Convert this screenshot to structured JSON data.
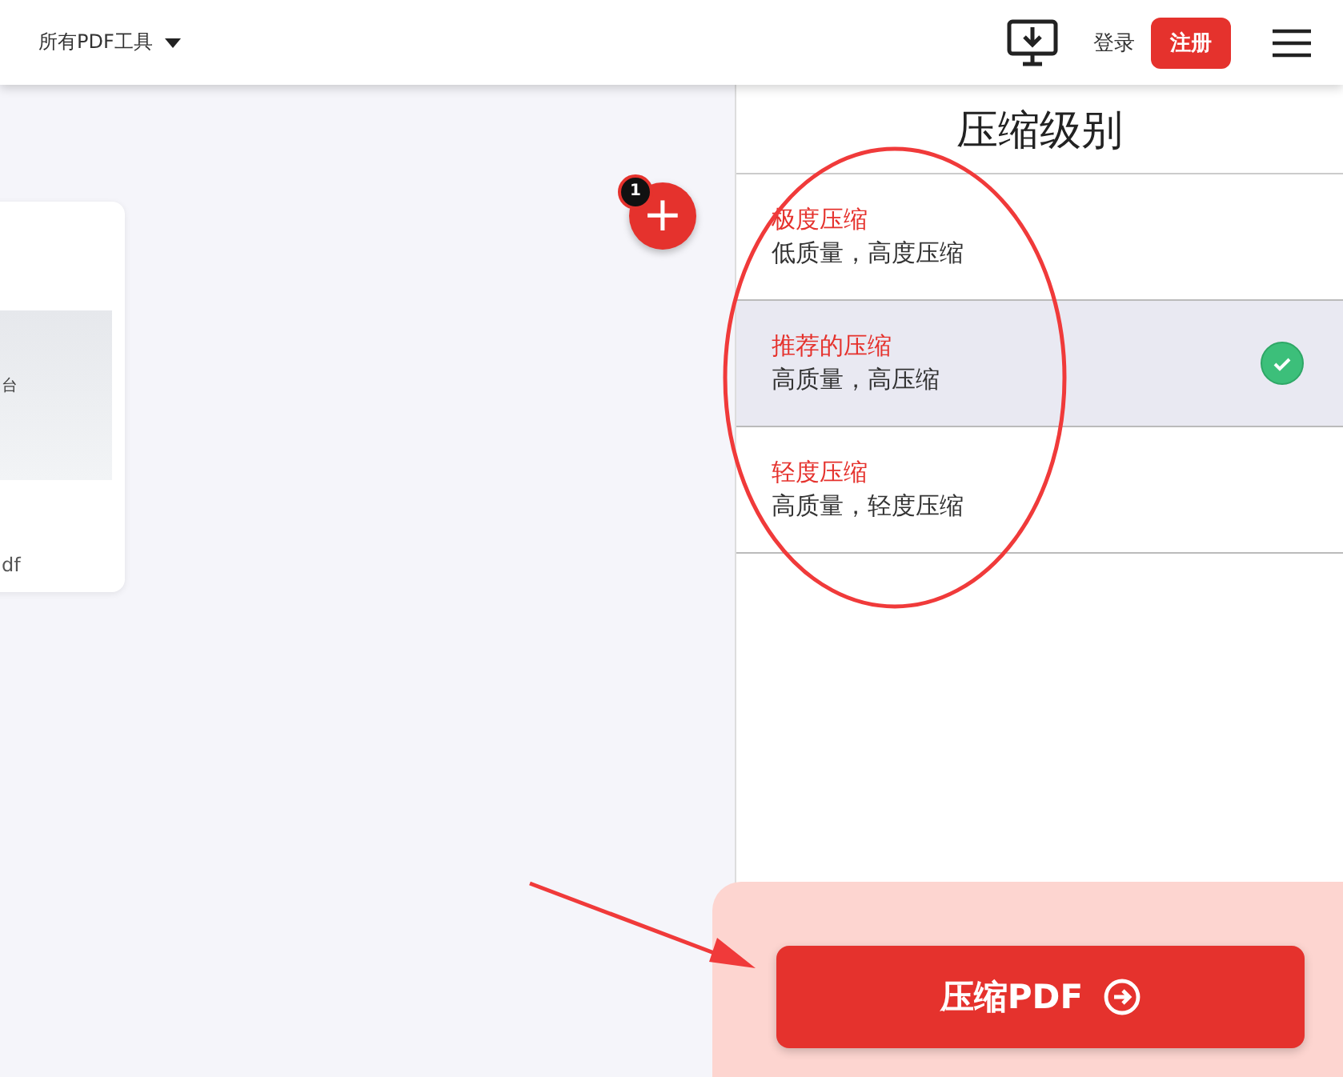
{
  "header": {
    "tools_menu": "所有PDF工具",
    "login": "登录",
    "register": "注册"
  },
  "file_card": {
    "thumbnail_text": "台",
    "file_name": "df"
  },
  "add_button": {
    "badge": "1",
    "icon": "+"
  },
  "panel": {
    "title": "压缩级别",
    "options": [
      {
        "title": "极度压缩",
        "description": "低质量，高度压缩",
        "selected": false
      },
      {
        "title": "推荐的压缩",
        "description": "高质量，高压缩",
        "selected": true
      },
      {
        "title": "轻度压缩",
        "description": "高质量，轻度压缩",
        "selected": false
      }
    ]
  },
  "action_button": {
    "label": "压缩PDF"
  }
}
